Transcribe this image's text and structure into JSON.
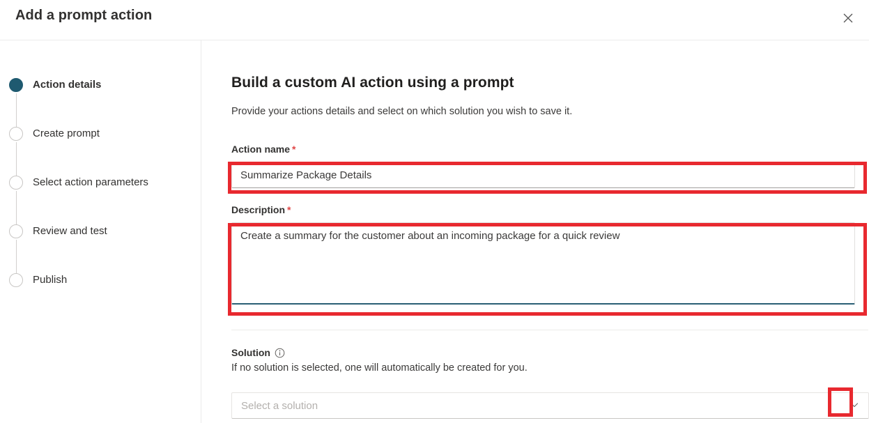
{
  "dialog": {
    "title": "Add a prompt action",
    "close_icon": "close-icon"
  },
  "sidebar": {
    "steps": [
      {
        "label": "Action details",
        "state": "active"
      },
      {
        "label": "Create prompt",
        "state": "inactive"
      },
      {
        "label": "Select action parameters",
        "state": "inactive"
      },
      {
        "label": "Review and test",
        "state": "inactive"
      },
      {
        "label": "Publish",
        "state": "inactive"
      }
    ]
  },
  "main": {
    "heading": "Build a custom AI action using a prompt",
    "subheading": "Provide your actions details and select on which solution you wish to save it.",
    "action_name": {
      "label": "Action name",
      "required_marker": "*",
      "value": "Summarize Package Details",
      "placeholder": ""
    },
    "description": {
      "label": "Description",
      "required_marker": "*",
      "value": "Create a summary for the customer about an incoming package for a quick review",
      "placeholder": ""
    },
    "solution": {
      "label": "Solution",
      "info_icon": "info-icon",
      "help_text": "If no solution is selected, one will automatically be created for you.",
      "placeholder": "Select a solution",
      "value": "",
      "chevron_icon": "chevron-down-icon"
    }
  },
  "annotations": {
    "accent_color": "#e8292f",
    "active_step_color": "#1f5a70",
    "focus_underline_color": "#2a5e74",
    "required_color": "#e04646"
  }
}
